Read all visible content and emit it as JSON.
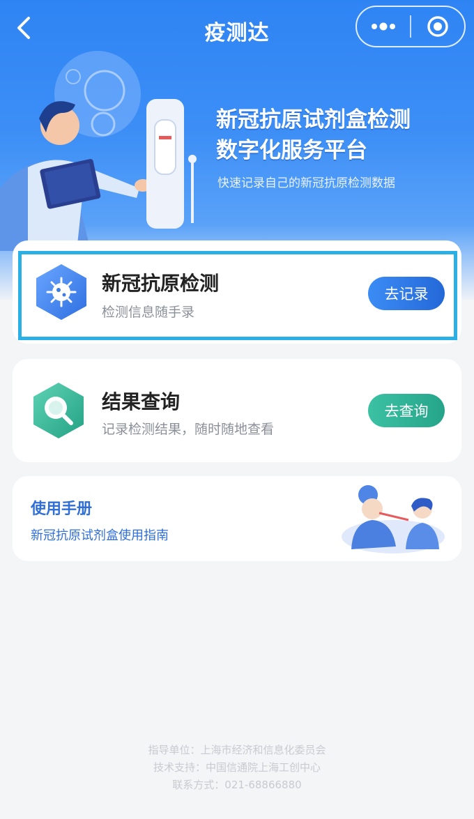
{
  "navbar": {
    "title": "疫测达",
    "back_icon": "chevron-left-icon",
    "more_icon": "more-dots-icon",
    "close_icon": "target-circle-icon"
  },
  "hero": {
    "title_line1": "新冠抗原试剂盒检测",
    "title_line2": "数字化服务平台",
    "subtitle": "快速记录自己的新冠抗原检测数据"
  },
  "cards": [
    {
      "title": "新冠抗原检测",
      "desc": "检测信息随手录",
      "button": "去记录",
      "icon": "virus-icon"
    },
    {
      "title": "结果查询",
      "desc": "记录检测结果，随时随地查看",
      "button": "去查询",
      "icon": "magnifier-icon"
    }
  ],
  "manual": {
    "title": "使用手册",
    "desc": "新冠抗原试剂盒使用指南"
  },
  "footer": {
    "sponsor": "指导单位：上海市经济和信息化委员会",
    "tech": "技术支持：中国信通院上海工创中心",
    "contact": "联系方式：021-68866880"
  },
  "colors": {
    "primary": "#2f84f4",
    "accent_green": "#2fb497",
    "highlight_frame": "#2ab0e4"
  }
}
